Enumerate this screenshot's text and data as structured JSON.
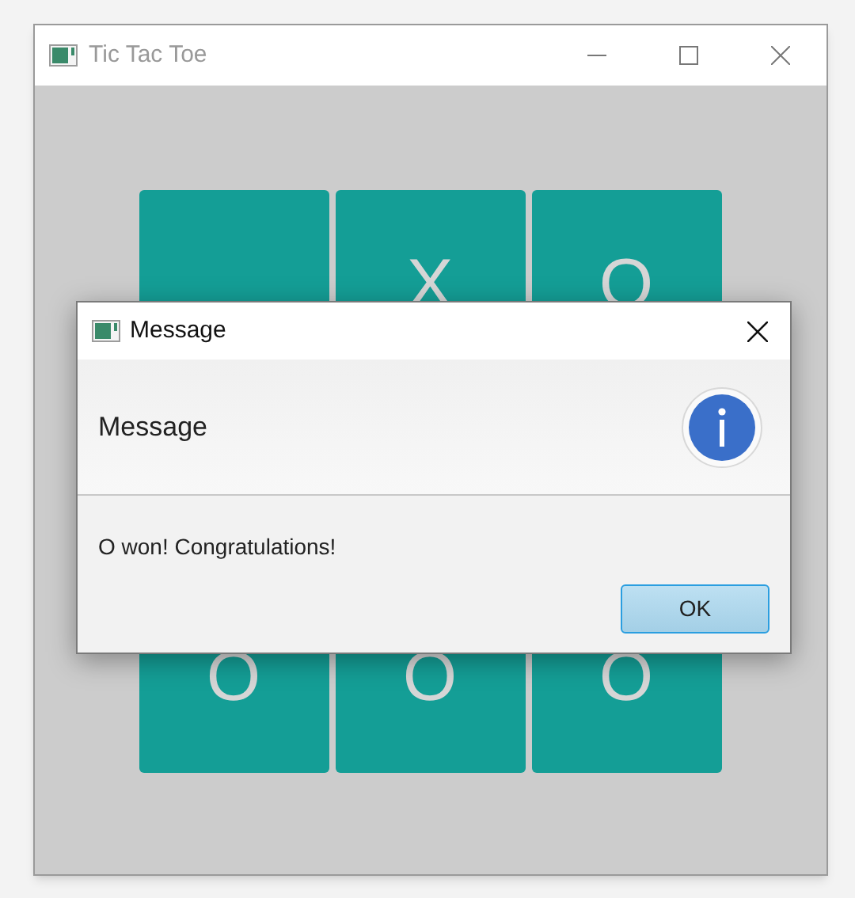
{
  "window": {
    "title": "Tic Tac Toe",
    "active": false
  },
  "board": {
    "top_row": [
      {
        "kind": "empty"
      },
      {
        "kind": "mark",
        "text": "X"
      },
      {
        "kind": "mark",
        "text": "O"
      }
    ],
    "bottom_row": [
      {
        "kind": "mark",
        "text": "O"
      },
      {
        "kind": "mark",
        "text": "O"
      },
      {
        "kind": "mark",
        "text": "O"
      }
    ]
  },
  "dialog": {
    "title": "Message",
    "header": "Message",
    "message": "O won! Congratulations!",
    "buttons": [
      {
        "label": "OK",
        "default": true
      }
    ]
  }
}
